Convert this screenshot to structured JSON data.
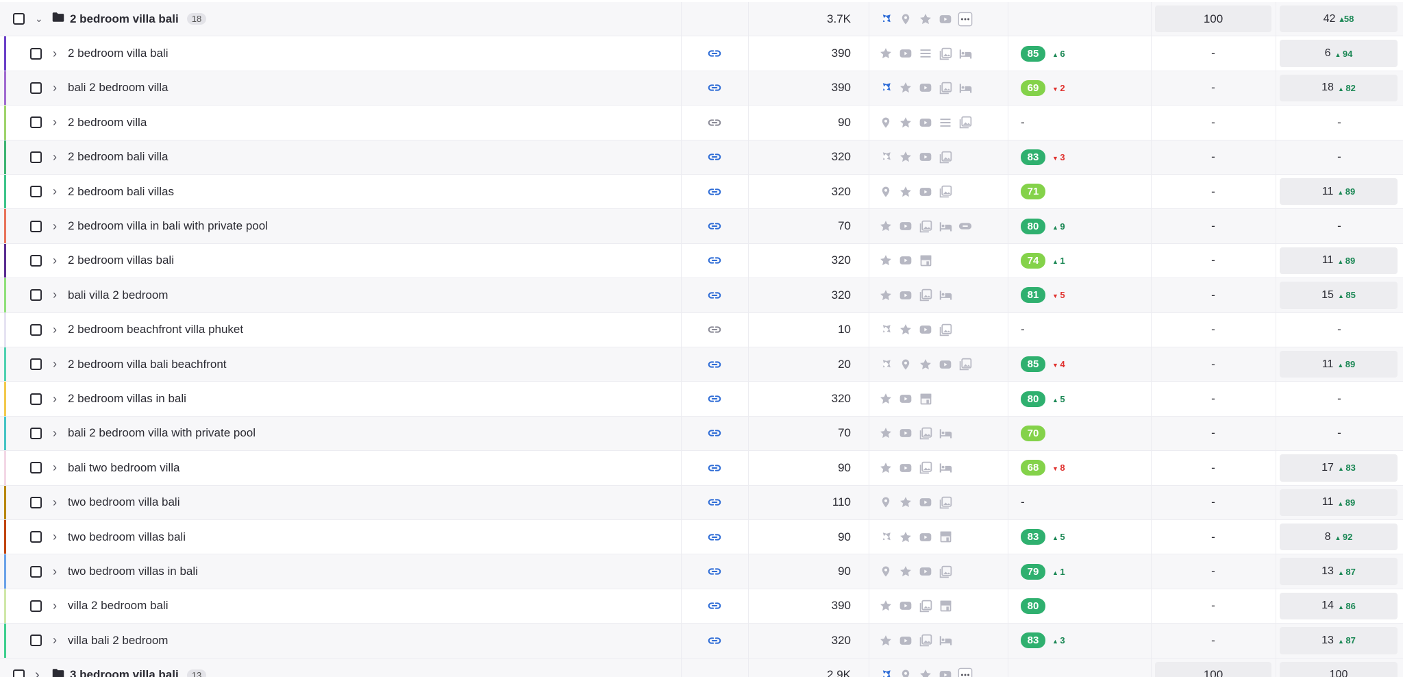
{
  "colors": {
    "link_icon": "#2e6cd6",
    "link_icon_muted": "#8a8a96",
    "feature_icon": "#b7b8c3",
    "feature_active": "#2e6cd6",
    "kd_dark": "#2fb06f",
    "kd_light": "#84d24a",
    "delta_up": "#1a8754",
    "delta_down": "#e0322f"
  },
  "group": {
    "keyword": "2 bedroom villa bali",
    "count": "18",
    "volume": "3.7K",
    "features": [
      "site-links-icon",
      "location-pin-icon",
      "star-icon",
      "video-icon",
      "more-icon"
    ],
    "col7": "100",
    "position": "42",
    "position_delta": "58"
  },
  "rows": [
    {
      "keyword": "2 bedroom villa bali",
      "stripe": "#6a3fc8",
      "link": "active",
      "volume": "390",
      "features": [
        "star-icon",
        "video-icon",
        "list-icon",
        "image-icon",
        "hotel-icon"
      ],
      "kd": "85",
      "kd_tone": "dark",
      "kd_delta": "6",
      "kd_dir": "up",
      "col7": "-",
      "position": "6",
      "position_delta": "94"
    },
    {
      "keyword": "bali 2 bedroom villa",
      "stripe": "#a06ad0",
      "link": "active",
      "volume": "390",
      "features": [
        "site-links-icon",
        "star-icon",
        "video-icon",
        "image-icon",
        "hotel-icon"
      ],
      "features_active": [
        "site-links-icon"
      ],
      "kd": "69",
      "kd_tone": "light",
      "kd_delta": "2",
      "kd_dir": "down",
      "col7": "-",
      "position": "18",
      "position_delta": "82"
    },
    {
      "keyword": "2 bedroom villa",
      "stripe": "#9ed36a",
      "link": "muted",
      "volume": "90",
      "features": [
        "location-pin-icon",
        "star-icon",
        "video-icon",
        "list-icon",
        "image-icon"
      ],
      "kd": "-",
      "kd_tone": "",
      "kd_delta": "",
      "kd_dir": "",
      "col7": "-",
      "position": "-",
      "position_delta": ""
    },
    {
      "keyword": "2 bedroom bali villa",
      "stripe": "#3cb371",
      "link": "active",
      "volume": "320",
      "features": [
        "site-links-icon",
        "star-icon",
        "video-icon",
        "image-icon"
      ],
      "kd": "83",
      "kd_tone": "dark",
      "kd_delta": "3",
      "kd_dir": "down",
      "col7": "-",
      "position": "-",
      "position_delta": ""
    },
    {
      "keyword": "2 bedroom bali villas",
      "stripe": "#3cc48a",
      "link": "active",
      "volume": "320",
      "features": [
        "location-pin-icon",
        "star-icon",
        "video-icon",
        "image-icon"
      ],
      "kd": "71",
      "kd_tone": "light",
      "kd_delta": "",
      "kd_dir": "",
      "col7": "-",
      "position": "11",
      "position_delta": "89"
    },
    {
      "keyword": "2 bedroom villa in bali with private pool",
      "stripe": "#e8735a",
      "link": "active",
      "volume": "70",
      "features": [
        "star-icon",
        "video-icon",
        "image-icon",
        "hotel-icon",
        "link-chip-icon"
      ],
      "kd": "80",
      "kd_tone": "dark",
      "kd_delta": "9",
      "kd_dir": "up",
      "col7": "-",
      "position": "-",
      "position_delta": ""
    },
    {
      "keyword": "2 bedroom villas bali",
      "stripe": "#5a2d91",
      "link": "active",
      "volume": "320",
      "features": [
        "star-icon",
        "video-icon",
        "store-icon"
      ],
      "kd": "74",
      "kd_tone": "light",
      "kd_delta": "1",
      "kd_dir": "up",
      "col7": "-",
      "position": "11",
      "position_delta": "89"
    },
    {
      "keyword": "bali villa 2 bedroom",
      "stripe": "#8fe07a",
      "link": "active",
      "volume": "320",
      "features": [
        "star-icon",
        "video-icon",
        "image-icon",
        "hotel-icon"
      ],
      "kd": "81",
      "kd_tone": "dark",
      "kd_delta": "5",
      "kd_dir": "down",
      "col7": "-",
      "position": "15",
      "position_delta": "85"
    },
    {
      "keyword": "2 bedroom beachfront villa phuket",
      "stripe": "#e6e3f2",
      "link": "muted",
      "volume": "10",
      "features": [
        "site-links-icon",
        "star-icon",
        "video-icon",
        "image-icon"
      ],
      "kd": "-",
      "kd_tone": "",
      "kd_delta": "",
      "kd_dir": "",
      "col7": "-",
      "position": "-",
      "position_delta": ""
    },
    {
      "keyword": "2 bedroom villa bali beachfront",
      "stripe": "#4fd1b0",
      "link": "active",
      "volume": "20",
      "features": [
        "site-links-icon",
        "location-pin-icon",
        "star-icon",
        "video-icon",
        "image-icon"
      ],
      "kd": "85",
      "kd_tone": "dark",
      "kd_delta": "4",
      "kd_dir": "down",
      "col7": "-",
      "position": "11",
      "position_delta": "89"
    },
    {
      "keyword": "2 bedroom villas in bali",
      "stripe": "#f2c94c",
      "link": "active",
      "volume": "320",
      "features": [
        "star-icon",
        "video-icon",
        "store-icon"
      ],
      "kd": "80",
      "kd_tone": "dark",
      "kd_delta": "5",
      "kd_dir": "up",
      "col7": "-",
      "position": "-",
      "position_delta": ""
    },
    {
      "keyword": "bali 2 bedroom villa with private pool",
      "stripe": "#45c4c4",
      "link": "active",
      "volume": "70",
      "features": [
        "star-icon",
        "video-icon",
        "image-icon",
        "hotel-icon"
      ],
      "kd": "70",
      "kd_tone": "light",
      "kd_delta": "",
      "kd_dir": "",
      "col7": "-",
      "position": "-",
      "position_delta": ""
    },
    {
      "keyword": "bali two bedroom villa",
      "stripe": "#f3d7e6",
      "link": "active",
      "volume": "90",
      "features": [
        "star-icon",
        "video-icon",
        "image-icon",
        "hotel-icon"
      ],
      "kd": "68",
      "kd_tone": "light",
      "kd_delta": "8",
      "kd_dir": "down",
      "col7": "-",
      "position": "17",
      "position_delta": "83"
    },
    {
      "keyword": "two bedroom villa bali",
      "stripe": "#b8860b",
      "link": "active",
      "volume": "110",
      "features": [
        "location-pin-icon",
        "star-icon",
        "video-icon",
        "image-icon"
      ],
      "kd": "-",
      "kd_tone": "",
      "kd_delta": "",
      "kd_dir": "",
      "col7": "-",
      "position": "11",
      "position_delta": "89"
    },
    {
      "keyword": "two bedroom villas bali",
      "stripe": "#c1440e",
      "link": "active",
      "volume": "90",
      "features": [
        "site-links-icon",
        "star-icon",
        "video-icon",
        "store-icon"
      ],
      "kd": "83",
      "kd_tone": "dark",
      "kd_delta": "5",
      "kd_dir": "up",
      "col7": "-",
      "position": "8",
      "position_delta": "92"
    },
    {
      "keyword": "two bedroom villas in bali",
      "stripe": "#6aa2e8",
      "link": "active",
      "volume": "90",
      "features": [
        "location-pin-icon",
        "star-icon",
        "video-icon",
        "image-icon"
      ],
      "kd": "79",
      "kd_tone": "dark",
      "kd_delta": "1",
      "kd_dir": "up",
      "col7": "-",
      "position": "13",
      "position_delta": "87"
    },
    {
      "keyword": "villa 2 bedroom bali",
      "stripe": "#cfe8a8",
      "link": "active",
      "volume": "390",
      "features": [
        "star-icon",
        "video-icon",
        "image-icon",
        "store-icon"
      ],
      "kd": "80",
      "kd_tone": "dark",
      "kd_delta": "",
      "kd_dir": "",
      "col7": "-",
      "position": "14",
      "position_delta": "86"
    },
    {
      "keyword": "villa bali 2 bedroom",
      "stripe": "#3ecf8e",
      "link": "active",
      "volume": "320",
      "features": [
        "star-icon",
        "video-icon",
        "image-icon",
        "hotel-icon"
      ],
      "kd": "83",
      "kd_tone": "dark",
      "kd_delta": "3",
      "kd_dir": "up",
      "col7": "-",
      "position": "13",
      "position_delta": "87"
    }
  ],
  "next_group": {
    "keyword": "3 bedroom villa bali",
    "count": "13",
    "volume": "2.9K",
    "features": [
      "site-links-icon",
      "location-pin-icon",
      "star-icon",
      "video-icon",
      "more-icon"
    ],
    "col7": "100",
    "position": "100"
  }
}
